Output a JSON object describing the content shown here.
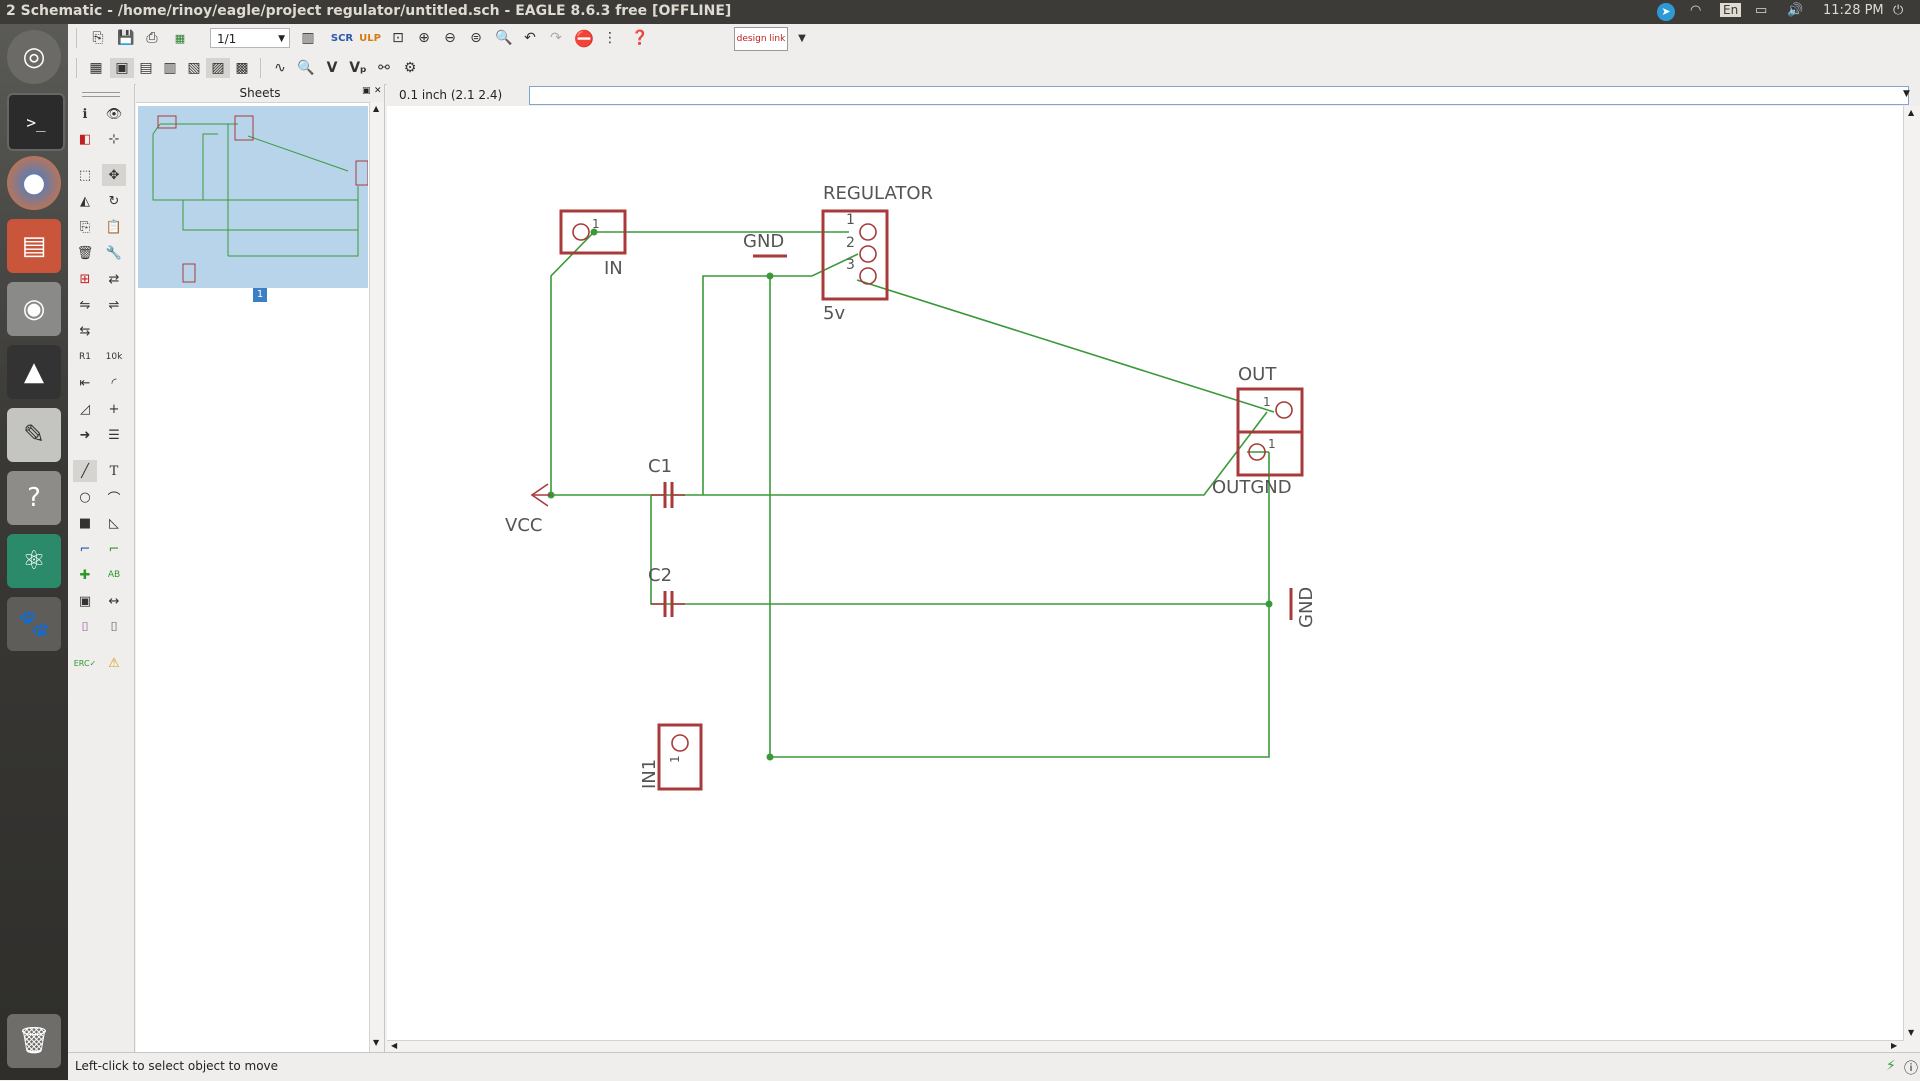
{
  "window": {
    "title": "2 Schematic - /home/rinoy/eagle/project regulator/untitled.sch - EAGLE 8.6.3 free [OFFLINE]"
  },
  "system_tray": {
    "keyboard": "En",
    "time": "11:28 PM"
  },
  "toolbar": {
    "sheet_select": "1/1"
  },
  "sheets_panel": {
    "title": "Sheets",
    "sheet_number": "1"
  },
  "canvas_header": {
    "grid_info": "0.1 inch (2.1 2.4)",
    "command_value": ""
  },
  "schematic": {
    "labels": {
      "regulator_name": "REGULATOR",
      "regulator_value": "5v",
      "pin1": "1",
      "pin2": "2",
      "pin3": "3",
      "in_name": "IN",
      "in_pin": "1",
      "gnd_top": "GND",
      "out_name": "OUT",
      "out_pin1": "1",
      "out_pin2": "1",
      "outgnd_name": "OUTGND",
      "c1": "C1",
      "c2": "C2",
      "vcc": "VCC",
      "gnd_right": "GND",
      "in1_name": "IN1",
      "in1_pin": "1"
    },
    "colors": {
      "wire": "#3a9a3a",
      "part": "#a83a3a",
      "text": "#555555"
    }
  },
  "status_bar": {
    "message": "Left-click to select object to move"
  }
}
